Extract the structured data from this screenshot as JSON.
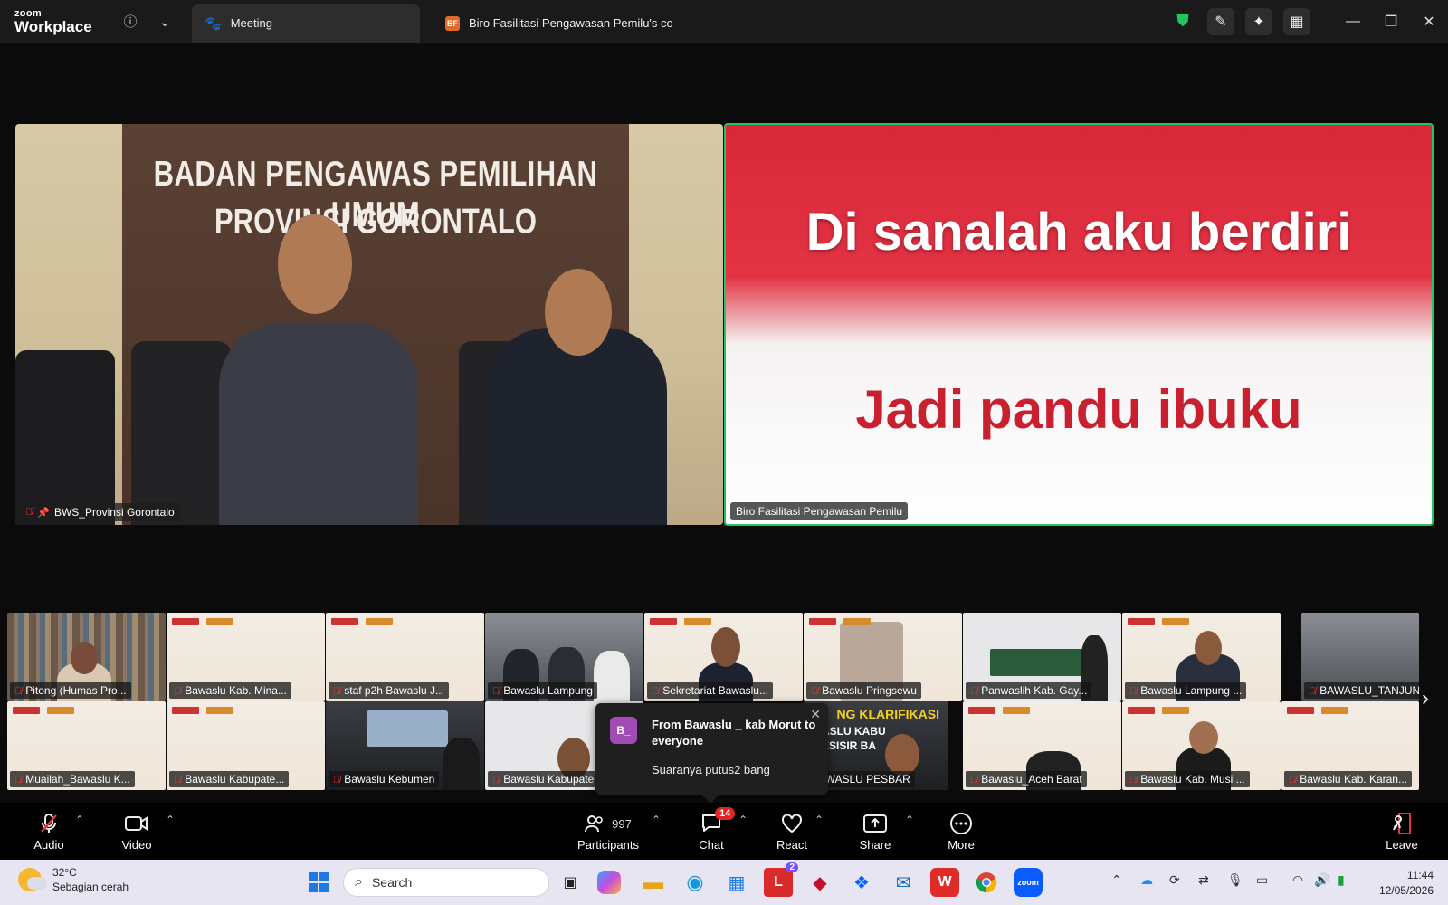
{
  "titlebar": {
    "brand_top": "zoom",
    "brand_bottom": "Workplace",
    "tabs": [
      {
        "label": "Meeting"
      },
      {
        "label": "Biro Fasilitasi Pengawasan Pemilu's co",
        "badge": "BF"
      }
    ]
  },
  "stage": {
    "left_video": {
      "label": "BWS_Provinsi Gorontalo",
      "panel_line1": "BADAN PENGAWAS PEMILIHAN UMUM",
      "panel_line2": "PROVINSI GORONTALO"
    },
    "right_video": {
      "label": "Biro Fasilitasi Pengawasan Pemilu",
      "line1": "Di sanalah aku berdiri",
      "line2": "Jadi pandu ibuku",
      "line1_color": "#ffffff",
      "line2_color": "#c8202f"
    }
  },
  "thumbnails": {
    "row1": [
      "Pitong (Humas Pro...",
      "Bawaslu Kab. Mina...",
      "staf p2h Bawaslu J...",
      "Bawaslu Lampung",
      "Sekretariat Bawaslu...",
      "Bawaslu Pringsewu",
      "Panwaslih Kab. Gay...",
      "Bawaslu Lampung ...",
      "BAWASLU_TANJUN..."
    ],
    "row2": [
      "Muailah_Bawaslu K...",
      "Bawaslu Kabupate...",
      "Bawaslu Kebumen",
      "Bawaslu Kabupate",
      "BAWASLU PESBAR",
      "Bawaslu_Aceh Barat",
      "Bawaslu Kab. Musi ...",
      "Bawaslu Kab. Karan..."
    ],
    "row2_overlay_text": "NG KLARIFIKASI",
    "row2_overlay_text2": "ASLU KABU",
    "row2_overlay_text3": "ESISIR BA"
  },
  "chat_popup": {
    "avatar": "B_",
    "from": "From Bawaslu _ kab Morut to everyone",
    "message": "Suaranya putus2 bang"
  },
  "toolbar": {
    "audio": "Audio",
    "video": "Video",
    "participants": "Participants",
    "participant_count": "997",
    "chat": "Chat",
    "chat_badge": "14",
    "react": "React",
    "share": "Share",
    "more": "More",
    "leave": "Leave"
  },
  "taskbar": {
    "weather_temp": "32°C",
    "weather_desc": "Sebagian cerah",
    "search_placeholder": "Search",
    "store_badge": "2",
    "time": "11:44",
    "date": "12/05/2026"
  },
  "colors": {
    "active_speaker_border": "#22c55e",
    "chat_badge": "#e02424",
    "accent_zoom": "#0b5cff"
  }
}
